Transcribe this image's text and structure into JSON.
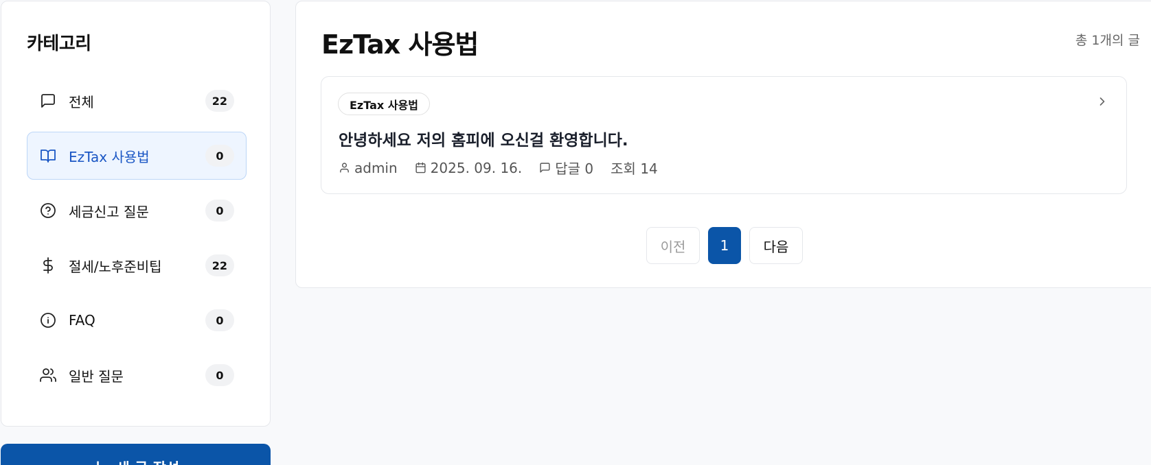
{
  "sidebar": {
    "title": "카테고리",
    "items": [
      {
        "label": "전체",
        "count": "22",
        "icon": "message-square-icon",
        "active": false
      },
      {
        "label": "EzTax 사용법",
        "count": "0",
        "icon": "book-open-icon",
        "active": true
      },
      {
        "label": "세금신고 질문",
        "count": "0",
        "icon": "help-circle-icon",
        "active": false
      },
      {
        "label": "절세/노후준비팁",
        "count": "22",
        "icon": "dollar-sign-icon",
        "active": false
      },
      {
        "label": "FAQ",
        "count": "0",
        "icon": "info-icon",
        "active": false
      },
      {
        "label": "일반 질문",
        "count": "0",
        "icon": "users-icon",
        "active": false
      }
    ],
    "write_button": {
      "icon": "plus-icon",
      "label": "새 글 작성"
    }
  },
  "main": {
    "title": "EzTax 사용법",
    "post_count": "총 1개의 글",
    "posts": [
      {
        "category": "EzTax 사용법",
        "title": "안녕하세요 저의 홈피에 오신걸 환영합니다.",
        "author": "admin",
        "date": "2025. 09. 16.",
        "replies": "답글 0",
        "views": "조회 14"
      }
    ],
    "pagination": {
      "prev": "이전",
      "current": "1",
      "next": "다음"
    }
  },
  "colors": {
    "primary": "#0b55a8",
    "active_bg": "#eef5ff",
    "active_text": "#1a56c4"
  }
}
